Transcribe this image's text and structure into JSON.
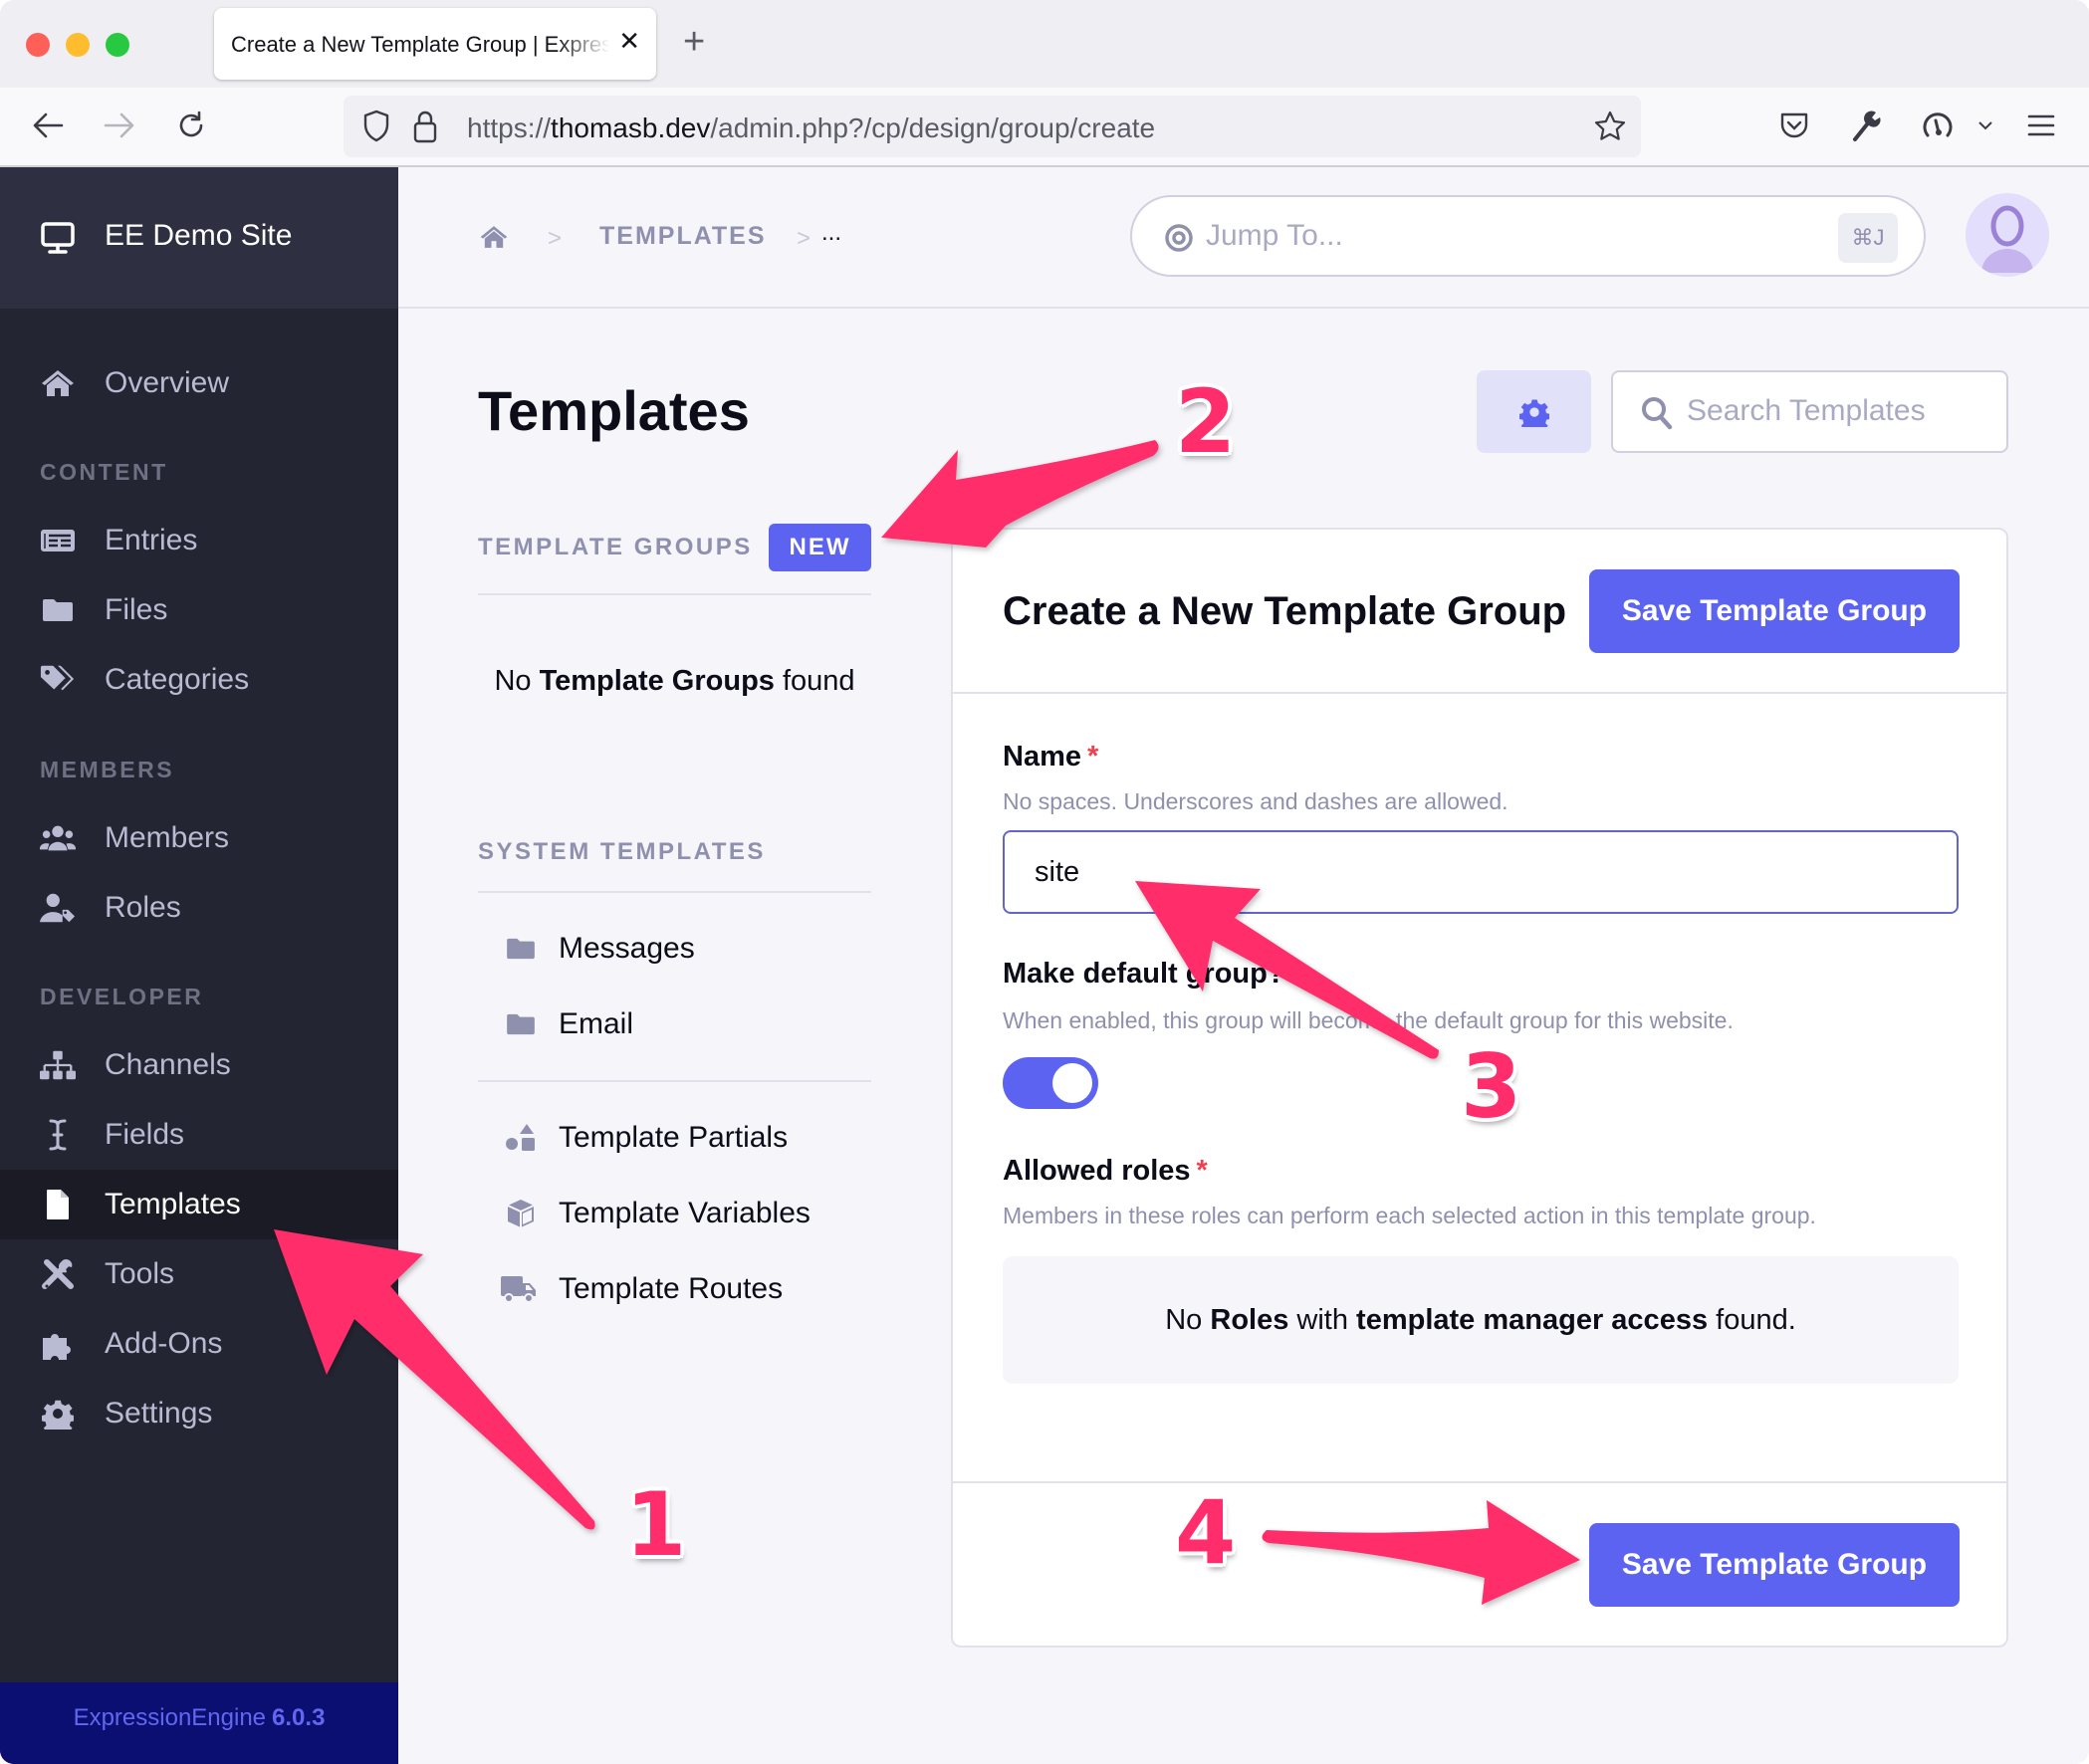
{
  "browser": {
    "tab_title": "Create a New Template Group | ExpressionEngine",
    "tab_close_icon": "close-icon",
    "new_tab_label": "+",
    "url_scheme": "https://",
    "url_host": "thomasb.dev",
    "url_path": "/admin.php?/cp/design/group/create"
  },
  "sidebar": {
    "site_name": "EE Demo Site",
    "top_items": [
      {
        "label": "Overview",
        "icon": "home-icon"
      }
    ],
    "sections": [
      {
        "title": "CONTENT",
        "items": [
          {
            "label": "Entries",
            "icon": "newspaper-icon"
          },
          {
            "label": "Files",
            "icon": "folder-icon"
          },
          {
            "label": "Categories",
            "icon": "tags-icon"
          }
        ]
      },
      {
        "title": "MEMBERS",
        "items": [
          {
            "label": "Members",
            "icon": "users-icon"
          },
          {
            "label": "Roles",
            "icon": "user-tag-icon"
          }
        ]
      },
      {
        "title": "DEVELOPER",
        "items": [
          {
            "label": "Channels",
            "icon": "sitemap-icon"
          },
          {
            "label": "Fields",
            "icon": "i-cursor-icon"
          },
          {
            "label": "Templates",
            "icon": "file-icon",
            "active": true
          },
          {
            "label": "Tools",
            "icon": "tools-icon"
          },
          {
            "label": "Add-Ons",
            "icon": "puzzle-icon"
          },
          {
            "label": "Settings",
            "icon": "cog-icon"
          }
        ]
      }
    ],
    "footer": {
      "product": "ExpressionEngine",
      "version": "6.0.3"
    }
  },
  "header": {
    "breadcrumb": [
      {
        "label": "home",
        "icon": "home-icon"
      },
      {
        "label": "TEMPLATES"
      },
      {
        "label": "..."
      }
    ],
    "jump_placeholder": "Jump To...",
    "jump_shortcut": "⌘J"
  },
  "main": {
    "title": "Templates",
    "search_placeholder": "Search Templates",
    "template_groups": {
      "heading": "TEMPLATE GROUPS",
      "new_label": "NEW",
      "empty_pre": "No ",
      "empty_bold": "Template Groups",
      "empty_post": " found"
    },
    "system_templates": {
      "heading": "SYSTEM TEMPLATES",
      "items": [
        {
          "label": "Messages",
          "icon": "folder-icon"
        },
        {
          "label": "Email",
          "icon": "folder-icon"
        }
      ]
    },
    "other_items": [
      {
        "label": "Template Partials",
        "icon": "shapes-icon"
      },
      {
        "label": "Template Variables",
        "icon": "cube-icon"
      },
      {
        "label": "Template Routes",
        "icon": "truck-icon"
      }
    ]
  },
  "form": {
    "title": "Create a New Template Group",
    "save_label": "Save Template Group",
    "name": {
      "label": "Name",
      "required_mark": "*",
      "description": "No spaces. Underscores and dashes are allowed.",
      "value": "site"
    },
    "make_default": {
      "label": "Make default group?",
      "description": "When enabled, this group will become the default group for this website.",
      "enabled": true
    },
    "allowed_roles": {
      "label": "Allowed roles",
      "required_mark": "*",
      "description": "Members in these roles can perform each selected action in this template group.",
      "empty_parts": [
        "No ",
        "Roles",
        " with ",
        "template manager access",
        " found."
      ]
    }
  },
  "annotations": {
    "color": "#ff2d6b",
    "steps": [
      "1",
      "2",
      "3",
      "4"
    ]
  },
  "colors": {
    "accent": "#5d63f1",
    "sidebar_bg": "#232532",
    "footer_bg": "#0c0f72",
    "required": "#e8434f"
  }
}
